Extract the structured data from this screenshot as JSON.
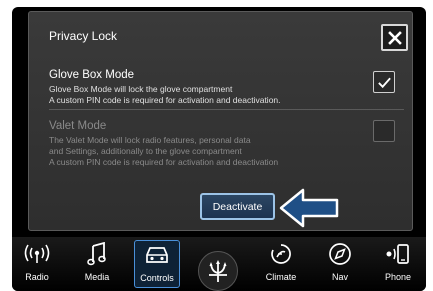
{
  "dialog": {
    "title": "Privacy Lock",
    "options": [
      {
        "title": "Glove Box Mode",
        "desc_lines": [
          "Glove Box Mode will lock the glove compartment",
          "A custom PIN code is required for activation and deactivation."
        ],
        "checked": true,
        "enabled": true
      },
      {
        "title": "Valet Mode",
        "desc_lines": [
          "The Valet Mode will lock radio features, personal data",
          "and Settings, additionally to the glove compartment",
          "A custom PIN code is required for activation and deactivation"
        ],
        "checked": false,
        "enabled": false
      }
    ],
    "deactivate_label": "Deactivate"
  },
  "navbar": {
    "items": [
      {
        "label": "Radio",
        "icon": "radio-icon"
      },
      {
        "label": "Media",
        "icon": "music-note-icon"
      },
      {
        "label": "Controls",
        "icon": "car-icon",
        "active": true
      },
      {
        "label": "Climate",
        "icon": "climate-icon"
      },
      {
        "label": "Nav",
        "icon": "compass-icon"
      },
      {
        "label": "Phone",
        "icon": "phone-icon"
      }
    ],
    "center_icon": "trident-logo-icon"
  },
  "colors": {
    "accent": "#4a90d9",
    "arrow": "#1f4f86",
    "background": "#000000"
  }
}
